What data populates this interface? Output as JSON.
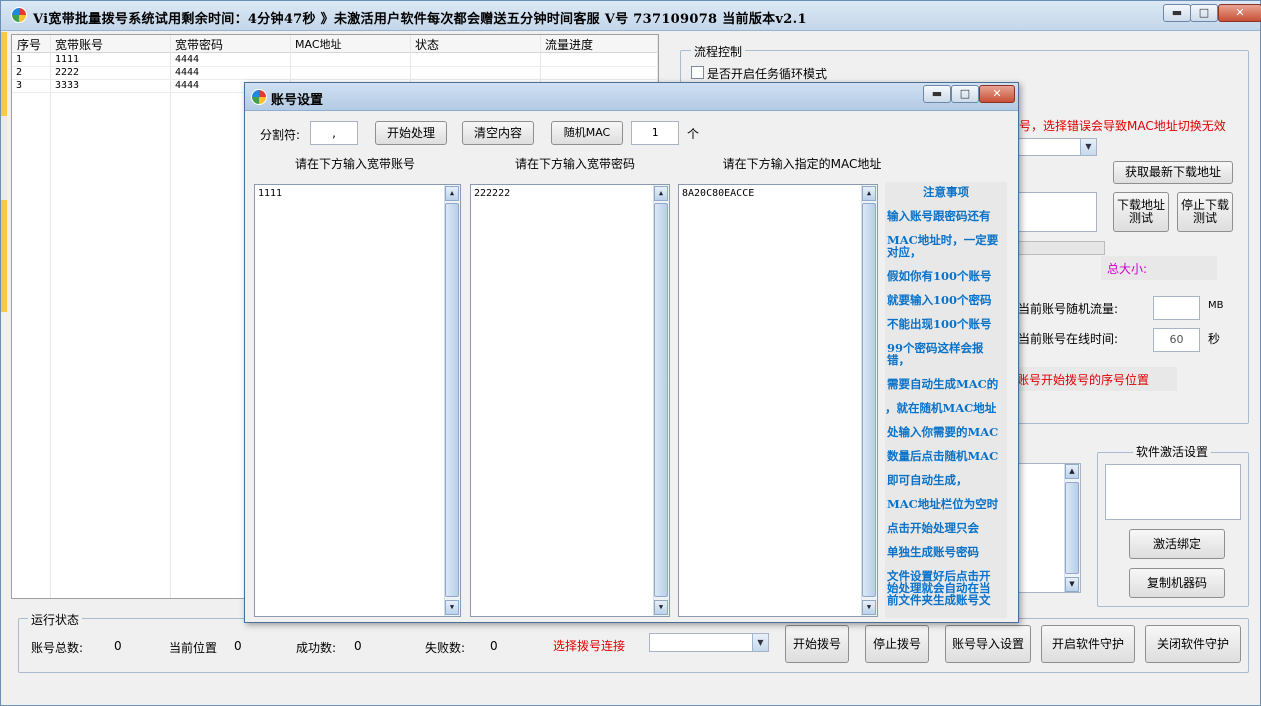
{
  "window": {
    "title": "Vi宽带批量拨号系统试用剩余时间：4分钟47秒  》未激活用户软件每次都会赠送五分钟时间客服  V号  737109078  当前版本v2.1",
    "min_label": "▬",
    "max_label": "□",
    "close_label": "✕"
  },
  "table": {
    "columns": [
      "序号",
      "宽带账号",
      "宽带密码",
      "MAC地址",
      "状态",
      "流量进度"
    ],
    "rows": [
      {
        "no": "1",
        "account": "1111",
        "password": "4444"
      },
      {
        "no": "2",
        "account": "2222",
        "password": "4444"
      },
      {
        "no": "3",
        "account": "3333",
        "password": "4444"
      }
    ]
  },
  "process": {
    "group_label": "流程控制",
    "loop_checkbox_label": "是否开启任务循环模式",
    "mac_warning": "号，选择错误会导致MAC地址切换无效",
    "get_download_btn": "获取最新下载地址",
    "download_test_btn": "下载地址\n测试",
    "stop_download_btn": "停止下载\n测试",
    "total_size_label": "总大小:",
    "random_traffic_label": "当前账号随机流量:",
    "traffic_unit": "MB",
    "online_time_label": "当前账号在线时间:",
    "online_time_value": "60",
    "time_unit": "秒",
    "start_position_label": "账号开始拨号的序号位置"
  },
  "activation": {
    "group_label": "软件激活设置",
    "activate_btn": "激活绑定",
    "copy_machine_btn": "复制机器码"
  },
  "status": {
    "group_label": "运行状态",
    "total_label": "账号总数:",
    "total_value": "0",
    "position_label": "当前位置",
    "position_value": "0",
    "success_label": "成功数:",
    "success_value": "0",
    "fail_label": "失败数:",
    "fail_value": "0",
    "connection_label": "选择拨号连接",
    "start_dial_btn": "开始拨号",
    "stop_dial_btn": "停止拨号",
    "import_btn": "账号导入设置",
    "enable_guard_btn": "开启软件守护",
    "disable_guard_btn": "关闭软件守护"
  },
  "dialog": {
    "title": "账号设置",
    "separator_label": "分割符:",
    "separator_value": ",",
    "start_process_btn": "开始处理",
    "clear_btn": "清空内容",
    "random_mac_btn": "随机MAC",
    "count_value": "1",
    "count_unit": "个",
    "account_col": "请在下方输入宽带账号",
    "password_col": "请在下方输入宽带密码",
    "mac_col": "请在下方输入指定的MAC地址",
    "account_text": "1111",
    "password_text": "222222",
    "mac_text": "8A20C80EACCE",
    "notes_title": "注意事项",
    "notes": [
      "输入账号跟密码还有",
      "MAC地址时，一定要",
      "对应，",
      "假如你有100个账号",
      "就要输入100个密码",
      "不能出现100个账号",
      "99个密码这样会报",
      "错，",
      "需要自动生成MAC的",
      "，就在随机MAC地址",
      "处输入你需要的MAC",
      "数量后点击随机MAC",
      "即可自动生成，",
      "MAC地址栏位为空时",
      "点击开始处理只会",
      "单独生成账号密码",
      "文件设置好后点击开",
      "始处理就会自动在当",
      "前文件夹生成账号文"
    ]
  },
  "colors": {
    "accent_blue": "#0a72c8",
    "warning_red": "#e00000",
    "magenta": "#cc00cc"
  }
}
